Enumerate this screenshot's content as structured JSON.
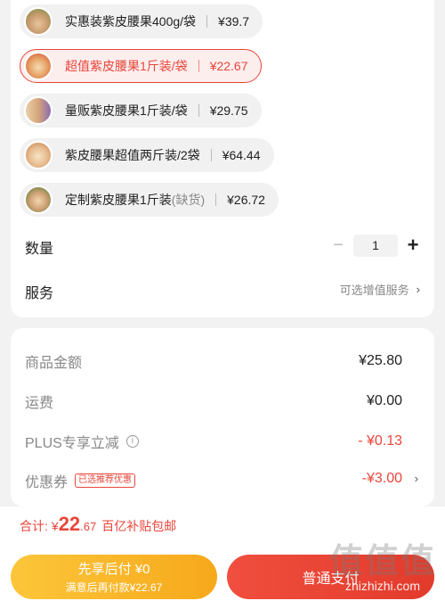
{
  "variants": [
    {
      "name": "实惠装紫皮腰果400g/袋",
      "sub": "",
      "price": "¥39.7"
    },
    {
      "name": "超值紫皮腰果1斤装/袋",
      "sub": "",
      "price": "¥22.67"
    },
    {
      "name": "量贩紫皮腰果1斤装/袋",
      "sub": "",
      "price": "¥29.75"
    },
    {
      "name": "紫皮腰果超值两斤装/2袋",
      "sub": "",
      "price": "¥64.44"
    },
    {
      "name": "定制紫皮腰果1斤装",
      "sub": "(缺货)",
      "price": "¥26.72"
    }
  ],
  "quantity": {
    "label": "数量",
    "minus": "−",
    "value": "1",
    "plus": "+"
  },
  "service": {
    "label": "服务",
    "value": "可选增值服务",
    "chevron": "›"
  },
  "amounts": {
    "goods_label": "商品金额",
    "goods_value": "¥25.80",
    "shipping_label": "运费",
    "shipping_value": "¥0.00",
    "plus_label": "PLUS专享立减",
    "plus_info": "i",
    "plus_value": "- ¥0.13",
    "coupon_label": "优惠券",
    "coupon_badge": "已选推荐优惠",
    "coupon_value": "-¥3.00",
    "coupon_chevron": "›"
  },
  "footer": {
    "total_label": "合计:",
    "total_currency": "¥",
    "total_int": "22",
    "total_dec": ".67",
    "total_note": "百亿补贴包邮",
    "later_title": "先享后付 ¥0",
    "later_sub": "满意后再付款¥22.67",
    "pay_label": "普通支付",
    "watermark": "值值值",
    "watermark_url": "zhizhizhi.com"
  },
  "colors": {
    "accent": "#e8463a",
    "later": "#f7a81b"
  },
  "selected_variant": 1
}
